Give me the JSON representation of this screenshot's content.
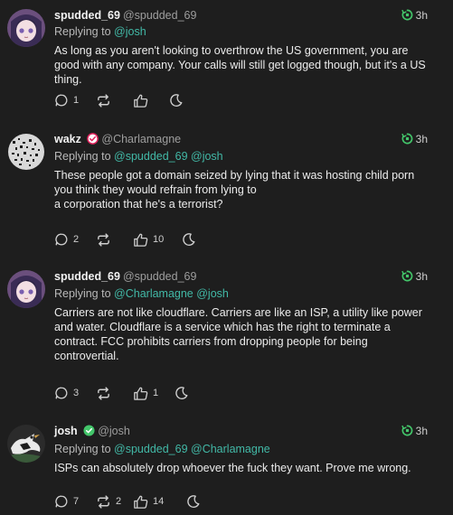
{
  "colors": {
    "background": "#1e1e1e",
    "mention": "#42b9a7",
    "text": "#ececec",
    "muted": "#9e9e9e"
  },
  "posts": [
    {
      "name": "spudded_69",
      "handle": "@spudded_69",
      "time": "3h",
      "reply_prefix": "Replying to",
      "reply_mentions": "@josh",
      "body": [
        "As long as you aren't looking to overthrow the US government, you are good with any company. Your calls will still get logged though, but it's a US thing."
      ],
      "replies": "1",
      "reposts": "",
      "likes": ""
    },
    {
      "name": "wakz",
      "handle": "@Charlamagne",
      "time": "3h",
      "reply_prefix": "Replying to",
      "reply_mentions": "@spudded_69 @josh",
      "body": [
        "These people got a domain seized by lying that it was hosting child porn you think they would refrain from lying to",
        "a corporation that he's a terrorist?"
      ],
      "replies": "2",
      "reposts": "",
      "likes": "10"
    },
    {
      "name": "spudded_69",
      "handle": "@spudded_69",
      "time": "3h",
      "reply_prefix": "Replying to",
      "reply_mentions": "@Charlamagne @josh",
      "body": [
        "Carriers are not like cloudflare. Carriers are like an ISP, a utility like power and water. Cloudflare is a service which has the right to terminate a contract. FCC prohibits carriers from dropping people for being controvertial."
      ],
      "replies": "3",
      "reposts": "",
      "likes": "1"
    },
    {
      "name": "josh",
      "handle": "@josh",
      "time": "3h",
      "reply_prefix": "Replying to",
      "reply_mentions": "@spudded_69 @Charlamagne",
      "body": [
        "ISPs can absolutely drop whoever the fuck they want. Prove me wrong."
      ],
      "replies": "7",
      "reposts": "2",
      "likes": "14"
    }
  ]
}
